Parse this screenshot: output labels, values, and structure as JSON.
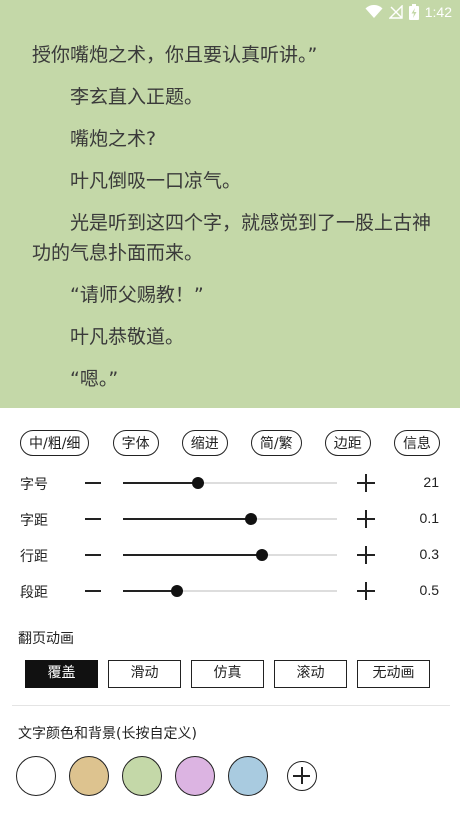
{
  "status_bar": {
    "time": "1:42"
  },
  "reader": {
    "paragraphs": [
      "授你嘴炮之术，你且要认真听讲。”",
      "李玄直入正题。",
      "嘴炮之术?",
      "叶凡倒吸一口凉气。",
      "光是听到这四个字，就感觉到了一股上古神功的气息扑面而来。",
      "“请师父赐教！”",
      "叶凡恭敬道。",
      "“嗯。”"
    ]
  },
  "panel": {
    "chips": [
      "中/粗/细",
      "字体",
      "缩进",
      "简/繁",
      "边距",
      "信息"
    ],
    "sliders": [
      {
        "label": "字号",
        "value": "21",
        "fraction": 0.35
      },
      {
        "label": "字距",
        "value": "0.1",
        "fraction": 0.6
      },
      {
        "label": "行距",
        "value": "0.3",
        "fraction": 0.65
      },
      {
        "label": "段距",
        "value": "0.5",
        "fraction": 0.25
      }
    ],
    "animation_title": "翻页动画",
    "animations": [
      "覆盖",
      "滑动",
      "仿真",
      "滚动",
      "无动画"
    ],
    "selected_animation": "覆盖",
    "color_title": "文字颜色和背景(长按自定义)",
    "swatches": [
      "#ffffff",
      "#ddc38f",
      "#c4d8a8",
      "#dcb4e2",
      "#a9cbe0"
    ]
  }
}
